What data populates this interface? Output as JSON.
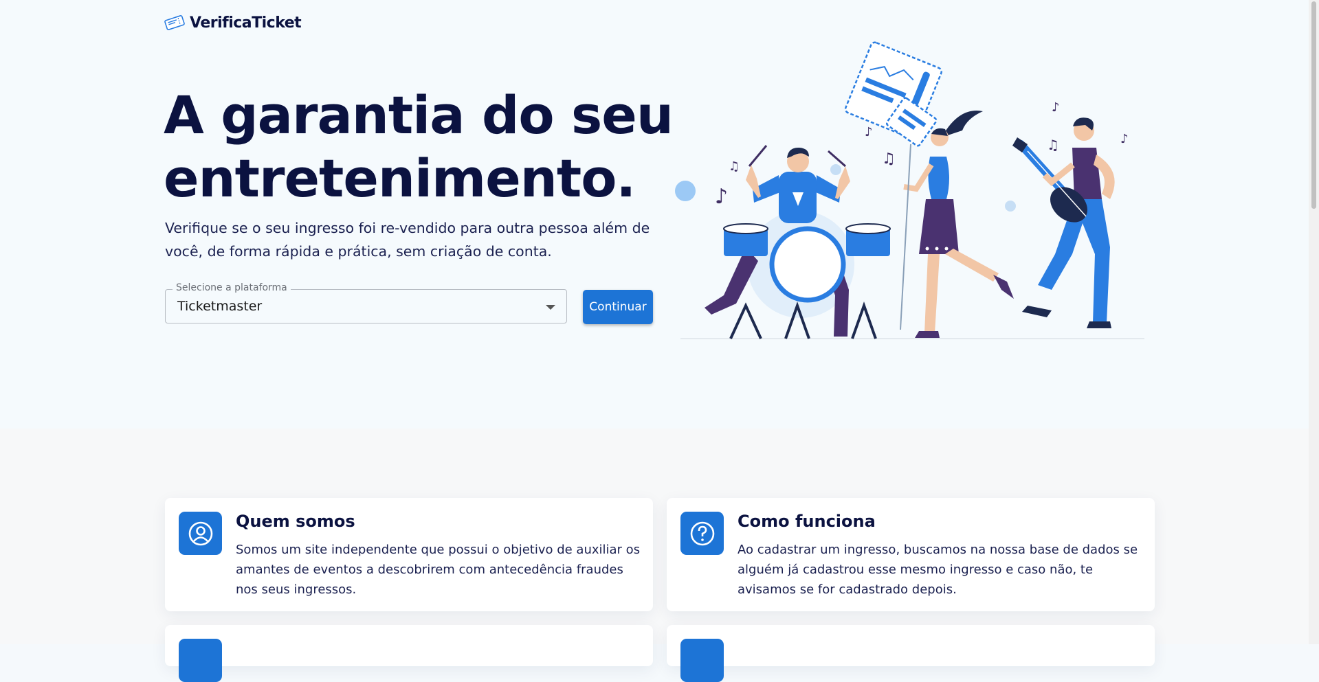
{
  "brand": {
    "name": "VerificaTicket",
    "logo_icon": "ticket-icon"
  },
  "hero": {
    "headline": "A garantia do seu entretenimento.",
    "subtitle": "Verifique se o seu ingresso foi re-vendido para outra pessoa além de você, de forma rápida e prática, sem criação de conta."
  },
  "form": {
    "select_label": "Selecione a plataforma",
    "selected_platform": "Ticketmaster",
    "continue_label": "Continuar"
  },
  "cards": [
    {
      "icon": "user-circle-icon",
      "title": "Quem somos",
      "text": "Somos um site independente que possui o objetivo de auxiliar os amantes de eventos a descobrirem com antecedência fraudes nos seus ingressos."
    },
    {
      "icon": "question-circle-icon",
      "title": "Como funciona",
      "text": "Ao cadastrar um ingresso, buscamos na nossa base de dados se alguém já cadastrou esse mesmo ingresso e caso não, te avisamos se for cadastrado depois."
    }
  ],
  "colors": {
    "primary": "#1d74d6",
    "heading": "#0b1240",
    "hero_background": "#f5fafd",
    "lower_background": "#f7f8f9"
  }
}
